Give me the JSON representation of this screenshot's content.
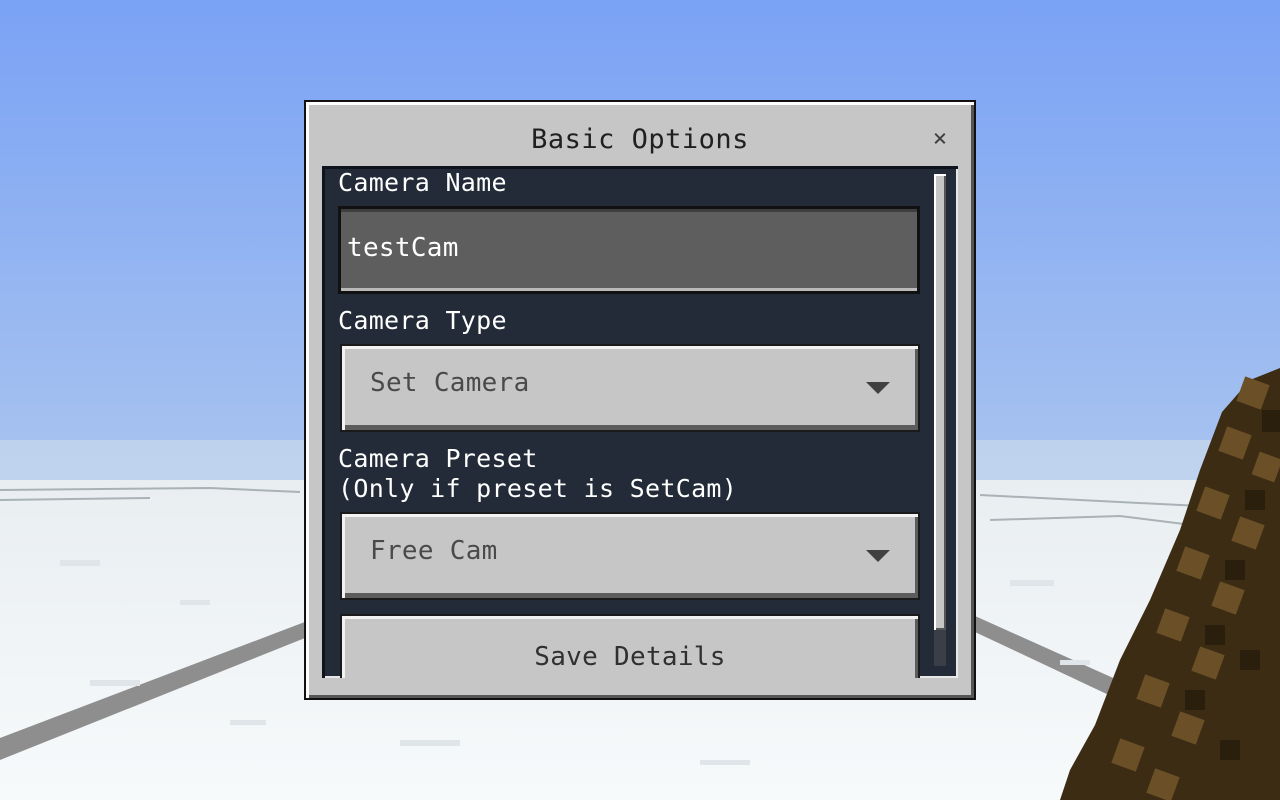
{
  "dialog": {
    "title": "Basic Options",
    "close_symbol": "×",
    "fields": {
      "camera_name": {
        "label": "Camera Name",
        "value": "testCam"
      },
      "camera_type": {
        "label": "Camera Type",
        "selected": "Set Camera"
      },
      "camera_preset": {
        "label": "Camera Preset",
        "sublabel": "(Only if preset is SetCam)",
        "selected": "Free Cam"
      }
    },
    "save_label": "Save Details"
  },
  "icons": {
    "close": "close-icon",
    "dropdown": "chevron-down-icon",
    "held_item": "stick-item-icon"
  },
  "colors": {
    "sky": "#8aaef7",
    "snow": "#f4f8fa",
    "panel": "#c6c6c6",
    "content_bg": "#232b38",
    "input_bg": "#5e5e5e"
  }
}
